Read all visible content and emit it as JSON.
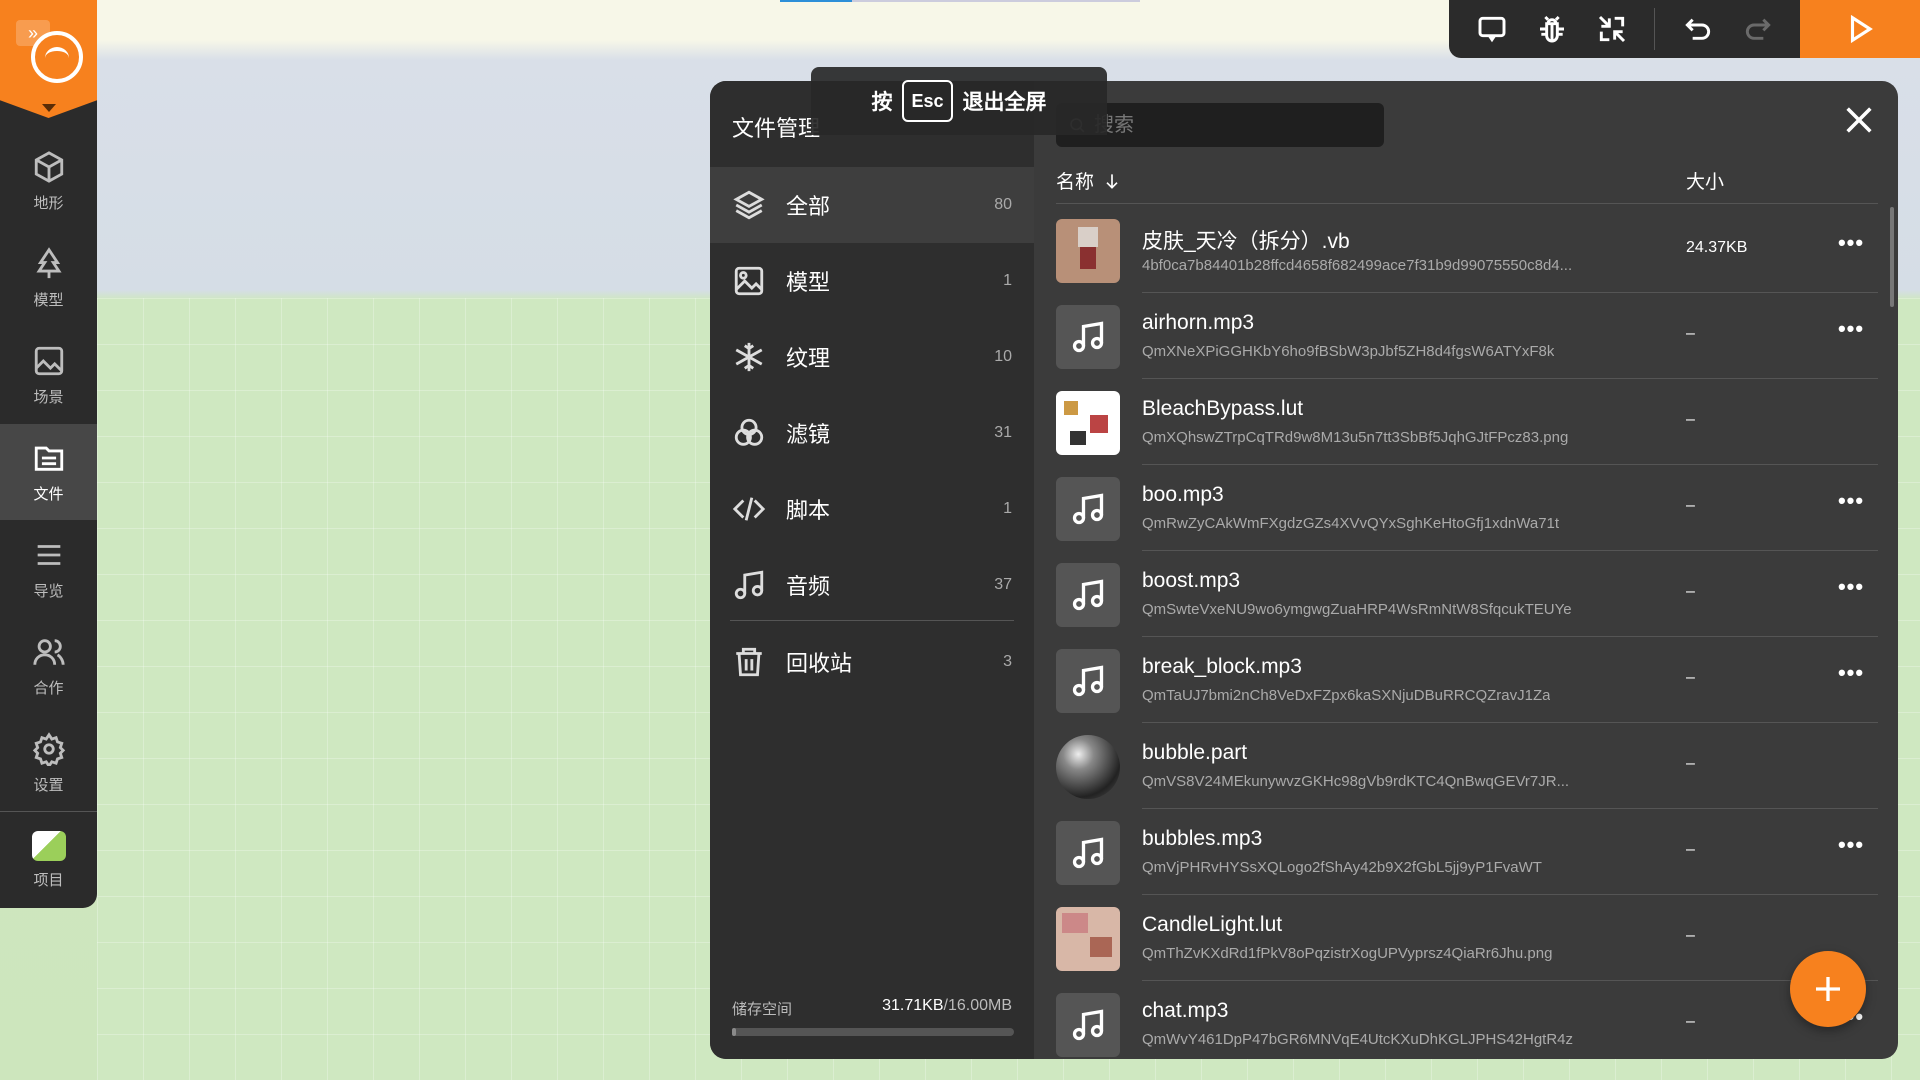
{
  "sidebar": {
    "items": [
      {
        "label": "地形",
        "icon": "cube-icon"
      },
      {
        "label": "模型",
        "icon": "tree-icon"
      },
      {
        "label": "场景",
        "icon": "image-icon"
      },
      {
        "label": "文件",
        "icon": "file-list-icon",
        "active": true
      },
      {
        "label": "导览",
        "icon": "list-icon"
      },
      {
        "label": "合作",
        "icon": "users-icon"
      },
      {
        "label": "设置",
        "icon": "gear-icon"
      },
      {
        "label": "项目",
        "icon": "project-thumbnail"
      }
    ]
  },
  "toolbar": {
    "buttons": [
      "comment-icon",
      "debug-icon",
      "fullscreen-exit-icon",
      "undo-icon",
      "redo-icon",
      "play-icon"
    ],
    "redo_disabled": true
  },
  "fullscreen_hint": {
    "prefix": "按",
    "key": "Esc",
    "suffix": "退出全屏"
  },
  "file_manager": {
    "title": "文件管理",
    "search_placeholder": "搜索",
    "categories": [
      {
        "label": "全部",
        "count": "80",
        "active": true
      },
      {
        "label": "模型",
        "count": "1"
      },
      {
        "label": "纹理",
        "count": "10"
      },
      {
        "label": "滤镜",
        "count": "31"
      },
      {
        "label": "脚本",
        "count": "1"
      },
      {
        "label": "音频",
        "count": "37"
      },
      {
        "label": "回收站",
        "count": "3"
      }
    ],
    "storage": {
      "label": "储存空间",
      "used": "31.71KB",
      "total": "/16.00MB",
      "fraction": 0.002
    },
    "columns": {
      "name": "名称",
      "size": "大小"
    },
    "files": [
      {
        "name": "皮肤_天冷（拆分）.vb",
        "hash": "4bf0ca7b84401b28ffcd4658f682499ace7f31b9d99075550c8d4...",
        "size": "24.37KB",
        "thumb": "skin"
      },
      {
        "name": "airhorn.mp3",
        "hash": "QmXNeXPiGGHKbY6ho9fBSbW3pJbf5ZH8d4fgsW6ATYxF8k",
        "size": "–",
        "thumb": "audio"
      },
      {
        "name": "BleachBypass.lut",
        "hash": "QmXQhswZTrpCqTRd9w8M13u5n7tt3SbBf5JqhGJtFPcz83.png",
        "size": "–",
        "thumb": "lut"
      },
      {
        "name": "boo.mp3",
        "hash": "QmRwZyCAkWmFXgdzGZs4XVvQYxSghKeHtoGfj1xdnWa71t",
        "size": "–",
        "thumb": "audio"
      },
      {
        "name": "boost.mp3",
        "hash": "QmSwteVxeNU9wo6ymgwgZuaHRP4WsRmNtW8SfqcukTEUYe",
        "size": "–",
        "thumb": "audio"
      },
      {
        "name": "break_block.mp3",
        "hash": "QmTaUJ7bmi2nCh8VeDxFZpx6kaSXNjuDBuRRCQZravJ1Za",
        "size": "–",
        "thumb": "audio"
      },
      {
        "name": "bubble.part",
        "hash": "QmVS8V24MEkunywvzGKHc98gVb9rdKTC4QnBwqGEVr7JR...",
        "size": "–",
        "thumb": "bubble"
      },
      {
        "name": "bubbles.mp3",
        "hash": "QmVjPHRvHYSsXQLogo2fShAy42b9X2fGbL5jj9yP1FvaWT",
        "size": "–",
        "thumb": "audio"
      },
      {
        "name": "CandleLight.lut",
        "hash": "QmThZvKXdRd1fPkV8oPqzistrXogUPVyprsz4QiaRr6Jhu.png",
        "size": "–",
        "thumb": "lut2"
      },
      {
        "name": "chat.mp3",
        "hash": "QmWvY461DpP47bGR6MNVqE4UtcKXuDhKGLJPHS42HgtR4z",
        "size": "–",
        "thumb": "audio"
      }
    ],
    "more_label": "•••"
  }
}
